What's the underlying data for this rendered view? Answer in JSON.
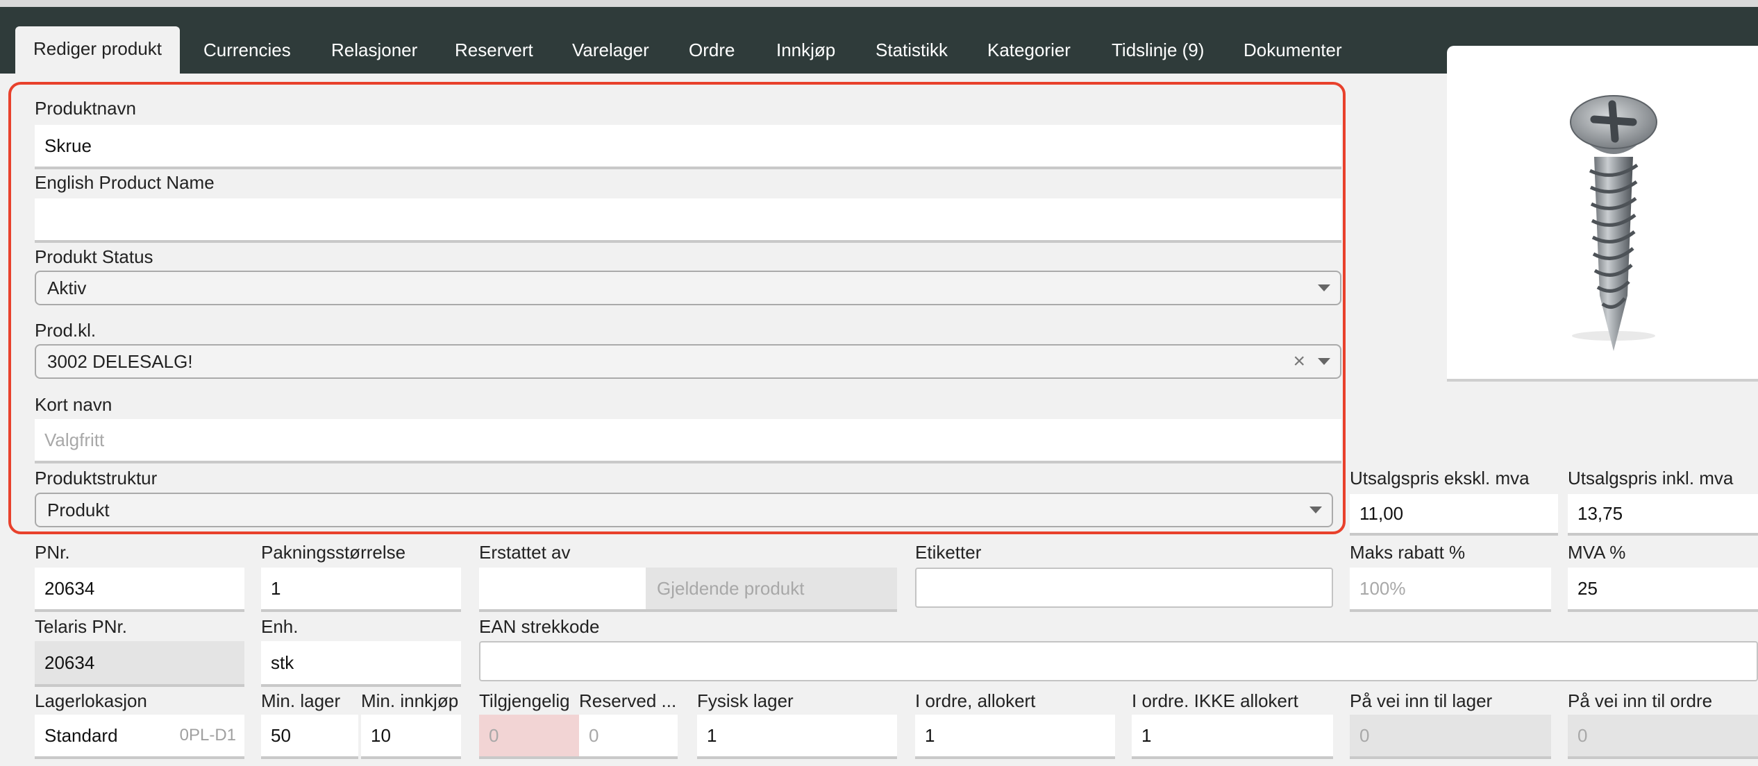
{
  "tabs": [
    {
      "label": "Rediger produkt",
      "active": true
    },
    {
      "label": "Currencies"
    },
    {
      "label": "Relasjoner"
    },
    {
      "label": "Reservert"
    },
    {
      "label": "Varelager"
    },
    {
      "label": "Ordre"
    },
    {
      "label": "Innkjøp"
    },
    {
      "label": "Statistikk"
    },
    {
      "label": "Kategorier"
    },
    {
      "label": "Tidslinje (9)"
    },
    {
      "label": "Dokumenter"
    }
  ],
  "form": {
    "produktnavn": {
      "label": "Produktnavn",
      "value": "Skrue"
    },
    "english_name": {
      "label": "English Product Name",
      "value": ""
    },
    "status": {
      "label": "Produkt Status",
      "value": "Aktiv"
    },
    "prodkl": {
      "label": "Prod.kl.",
      "value": "3002 DELESALG!"
    },
    "kortnavn": {
      "label": "Kort navn",
      "placeholder": "Valgfritt"
    },
    "produktstruktur": {
      "label": "Produktstruktur",
      "value": "Produkt"
    },
    "pnr": {
      "label": "PNr.",
      "value": "20634"
    },
    "pakning": {
      "label": "Pakningsstørrelse",
      "value": "1"
    },
    "erstattet": {
      "label": "Erstattet av",
      "value": "",
      "side": "Gjeldende produkt"
    },
    "etiketter": {
      "label": "Etiketter",
      "value": ""
    },
    "telaris": {
      "label": "Telaris PNr.",
      "value": "20634"
    },
    "enh": {
      "label": "Enh.",
      "value": "stk"
    },
    "ean": {
      "label": "EAN strekkode",
      "value": ""
    },
    "lagerlokasjon": {
      "label": "Lagerlokasjon",
      "value": "Standard",
      "code": "0PL-D1"
    },
    "min_lager": {
      "label": "Min. lager",
      "value": "50"
    },
    "min_innkjop": {
      "label": "Min. innkjøp",
      "value": "10"
    },
    "tilgjengelig": {
      "label": "Tilgjengelig",
      "value": "0"
    },
    "reserved": {
      "label": "Reserved ...",
      "value": "0"
    },
    "fysisk": {
      "label": "Fysisk lager",
      "value": "1"
    },
    "iordre_alloc": {
      "label": "I ordre, allokert",
      "value": "1"
    },
    "iordre_ikke": {
      "label": "I ordre. IKKE allokert",
      "value": "1"
    },
    "pavei_lager": {
      "label": "På vei inn til lager",
      "value": "0"
    },
    "pavei_ordre": {
      "label": "På vei inn til ordre",
      "value": "0"
    },
    "pris_eks": {
      "label": "Utsalgspris ekskl. mva",
      "value": "11,00"
    },
    "pris_inkl": {
      "label": "Utsalgspris inkl. mva",
      "value": "13,75"
    },
    "maks_rabatt": {
      "label": "Maks rabatt %",
      "placeholder": "100%"
    },
    "mva": {
      "label": "MVA %",
      "value": "25"
    }
  },
  "icons": {
    "product_image": "screw-image",
    "clear": "close-icon",
    "dropdown": "chevron-down-icon"
  },
  "colors": {
    "header": "#2f3b3a",
    "highlight": "#e8412c",
    "panel": "#f1f1f1"
  }
}
